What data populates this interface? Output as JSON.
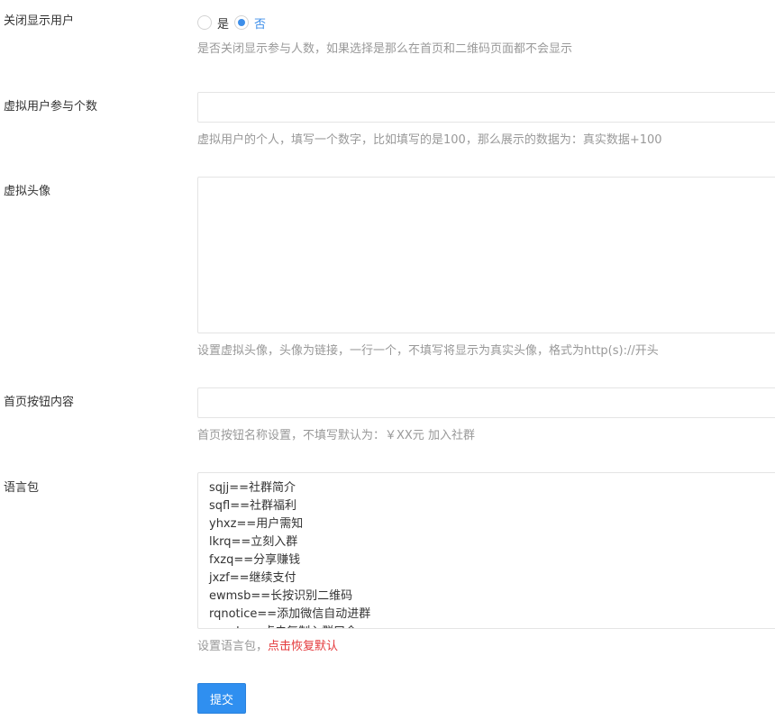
{
  "close_display": {
    "label": "关闭显示用户",
    "options": [
      "是",
      "否"
    ],
    "selected": "否",
    "help": "是否关闭显示参与人数，如果选择是那么在首页和二维码页面都不会显示"
  },
  "virtual_count": {
    "label": "虚拟用户参与个数",
    "value": "",
    "help": "虚拟用户的个人，填写一个数字，比如填写的是100，那么展示的数据为：真实数据+100"
  },
  "virtual_avatar": {
    "label": "虚拟头像",
    "value": "",
    "help": "设置虚拟头像，头像为链接，一行一个，不填写将显示为真实头像，格式为http(s)://开头"
  },
  "home_button": {
    "label": "首页按钮内容",
    "value": "",
    "help": "首页按钮名称设置，不填写默认为：￥XX元 加入社群"
  },
  "language_pack": {
    "label": "语言包",
    "value": "sqjj==社群简介\nsqfl==社群福利\nyhxz==用户需知\nlkrq==立刻入群\nfxzq==分享赚钱\njxzf==继续支付\newmsb==长按识别二维码\nrqnotice==添加微信自动进群\nsqgzh==点击复制入群口令",
    "help": "设置语言包，",
    "reset_link": "点击恢复默认"
  },
  "submit": {
    "label": "提交"
  },
  "colors": {
    "primary": "#2f8ff0",
    "radio_checked": "#3d8ee9",
    "reset_link": "#e4393c",
    "help_text": "#999999"
  }
}
